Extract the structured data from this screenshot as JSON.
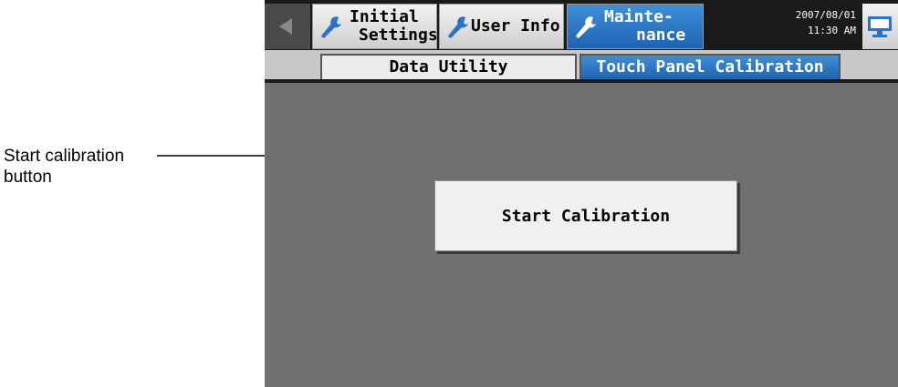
{
  "callout": {
    "line1": "Start calibration",
    "line2": "button"
  },
  "header": {
    "tabs": [
      {
        "line1": "Initial",
        "line2": "Settings",
        "icon": "wrench-icon"
      },
      {
        "line1": "User Info",
        "icon": "wrench-icon"
      },
      {
        "line1": "Mainte-",
        "line2": "nance",
        "icon": "wrench-icon",
        "active": true
      }
    ],
    "date": "2007/08/01",
    "time": "11:30 AM"
  },
  "subtabs": [
    {
      "label": "Data Utility"
    },
    {
      "label": "Touch Panel Calibration",
      "active": true
    }
  ],
  "main": {
    "start_button_label": "Start Calibration"
  },
  "colors": {
    "accent": "#2a73c6",
    "background": "#707070",
    "topbar": "#1a1a1a"
  }
}
